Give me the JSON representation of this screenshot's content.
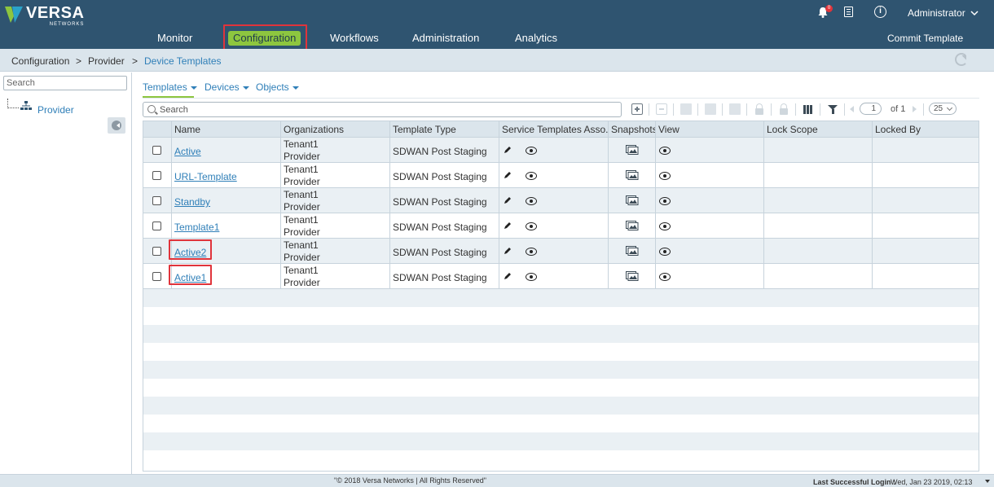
{
  "brand": {
    "name": "VERSA",
    "sub": "NETWORKS",
    "colors": {
      "header": "#2f5470",
      "accent": "#8dc63f",
      "link": "#2f7fb8",
      "highlight": "#e0343b"
    }
  },
  "nav": {
    "items": [
      "Monitor",
      "Configuration",
      "Workflows",
      "Administration",
      "Analytics"
    ],
    "active": "Configuration"
  },
  "header": {
    "notifications_count": "0",
    "user": "Administrator",
    "commit_label": "Commit Template"
  },
  "breadcrumb": [
    "Configuration",
    ">",
    "Provider",
    ">",
    "Device Templates"
  ],
  "left": {
    "search_placeholder": "Search",
    "tree_root": "Provider"
  },
  "subtabs": [
    "Templates",
    "Devices",
    "Objects"
  ],
  "grid_search_placeholder": "Search",
  "pager": {
    "page": "1",
    "of_label": "of 1",
    "page_size": "25"
  },
  "columns": [
    "Name",
    "Organizations",
    "Template Type",
    "Service Templates Asso...",
    "Snapshots",
    "View",
    "Lock Scope",
    "Locked By"
  ],
  "rows": [
    {
      "name": "Active",
      "org1": "Tenant1",
      "org2": "Provider",
      "type": "SDWAN Post Staging",
      "highlighted": false
    },
    {
      "name": "URL-Template",
      "org1": "Tenant1",
      "org2": "Provider",
      "type": "SDWAN Post Staging",
      "highlighted": false
    },
    {
      "name": "Standby",
      "org1": "Tenant1",
      "org2": "Provider",
      "type": "SDWAN Post Staging",
      "highlighted": false
    },
    {
      "name": "Template1",
      "org1": "Tenant1",
      "org2": "Provider",
      "type": "SDWAN Post Staging",
      "highlighted": false
    },
    {
      "name": "Active2",
      "org1": "Tenant1",
      "org2": "Provider",
      "type": "SDWAN Post Staging",
      "highlighted": true
    },
    {
      "name": "Active1",
      "org1": "Tenant1",
      "org2": "Provider",
      "type": "SDWAN Post Staging",
      "highlighted": true
    }
  ],
  "footer": {
    "copyright": "\"© 2018 Versa Networks | All Rights Reserved\"",
    "last_login_label": "Last Successful Login :",
    "last_login_value": "Wed, Jan 23 2019, 02:13"
  }
}
